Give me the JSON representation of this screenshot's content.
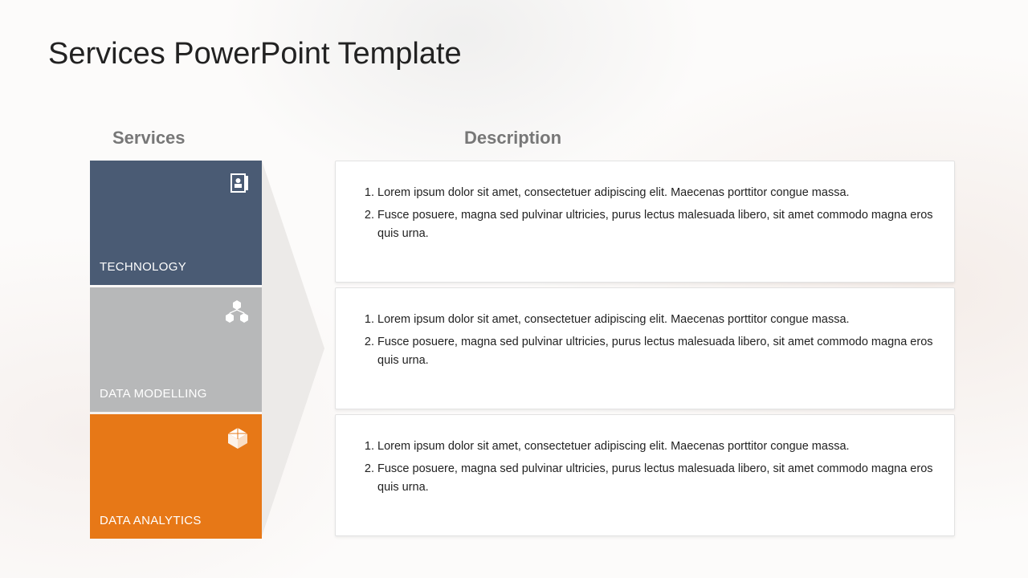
{
  "title": "Services PowerPoint Template",
  "columns": {
    "left": "Services",
    "right": "Description"
  },
  "cards": [
    {
      "label": "TECHNOLOGY"
    },
    {
      "label": "DATA MODELLING"
    },
    {
      "label": "DATA ANALYTICS"
    }
  ],
  "descriptions": [
    {
      "item1": "Lorem ipsum dolor sit amet, consectetuer adipiscing elit. Maecenas porttitor congue massa.",
      "item2": "Fusce posuere, magna sed pulvinar ultricies, purus lectus malesuada libero, sit amet commodo magna eros quis urna."
    },
    {
      "item1": "Lorem ipsum dolor sit amet, consectetuer adipiscing elit. Maecenas porttitor congue massa.",
      "item2": "Fusce posuere, magna sed pulvinar ultricies, purus lectus malesuada libero, sit amet commodo magna eros quis urna."
    },
    {
      "item1": "Lorem ipsum dolor sit amet, consectetuer adipiscing elit. Maecenas porttitor congue massa.",
      "item2": "Fusce posuere, magna sed pulvinar ultricies, purus lectus malesuada libero, sit amet commodo magna eros quis urna."
    }
  ]
}
